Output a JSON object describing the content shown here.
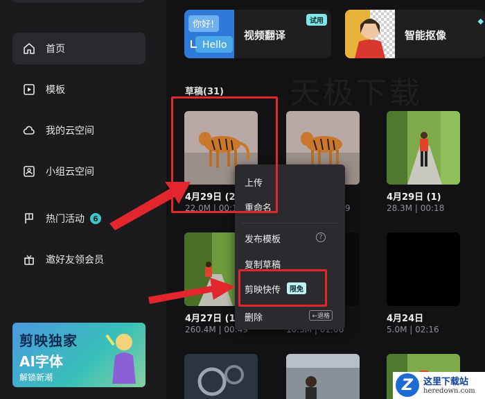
{
  "sidebar": {
    "items": [
      {
        "label": "首页",
        "icon": "home-icon",
        "active": true
      },
      {
        "label": "模板",
        "icon": "template-icon"
      },
      {
        "label": "我的云空间",
        "icon": "cloud-icon"
      },
      {
        "label": "小组云空间",
        "icon": "group-cloud-icon"
      },
      {
        "label": "热门活动",
        "icon": "flag-icon",
        "badge": "6"
      },
      {
        "label": "邀好友领会员",
        "icon": "gift-icon"
      }
    ],
    "promo": {
      "line1": "剪映独家",
      "line2": "AI字体",
      "line3": "解锁新潮"
    }
  },
  "feature_cards": [
    {
      "label": "视频翻译",
      "thumb_text_top": "你好!",
      "thumb_text_bottom": "Hello",
      "tag": "试用"
    },
    {
      "label": "智能抠像"
    }
  ],
  "watermark": "天极下载",
  "drafts": {
    "title": "草稿(31)",
    "items": [
      {
        "name": "4月29日 (2",
        "meta": "22.0M | 00:18"
      },
      {
        "name": "",
        "meta": "9"
      },
      {
        "name": "4月29日 (1)",
        "meta": "28.3M | 00:18"
      },
      {
        "name": "4月27日 (1",
        "meta": "260.4M | 00:49"
      },
      {
        "name": "",
        "meta": "10.3M | 01:00"
      },
      {
        "name": "4月24日",
        "meta": "5.0M | 02:16"
      }
    ]
  },
  "context_menu": {
    "upload": "上传",
    "rename": "重命名",
    "publish_template": "发布模板",
    "help": "?",
    "copy_draft": "复制草稿",
    "quick_upload": "剪映快传",
    "free_tag": "限免",
    "delete": "删除",
    "delete_key": "←退格"
  },
  "site_logo": {
    "letter": "Z",
    "title": "这里下载站",
    "url": "heredown.com"
  },
  "colors": {
    "accent": "#3ec7c7",
    "highlight": "#e3262d"
  }
}
